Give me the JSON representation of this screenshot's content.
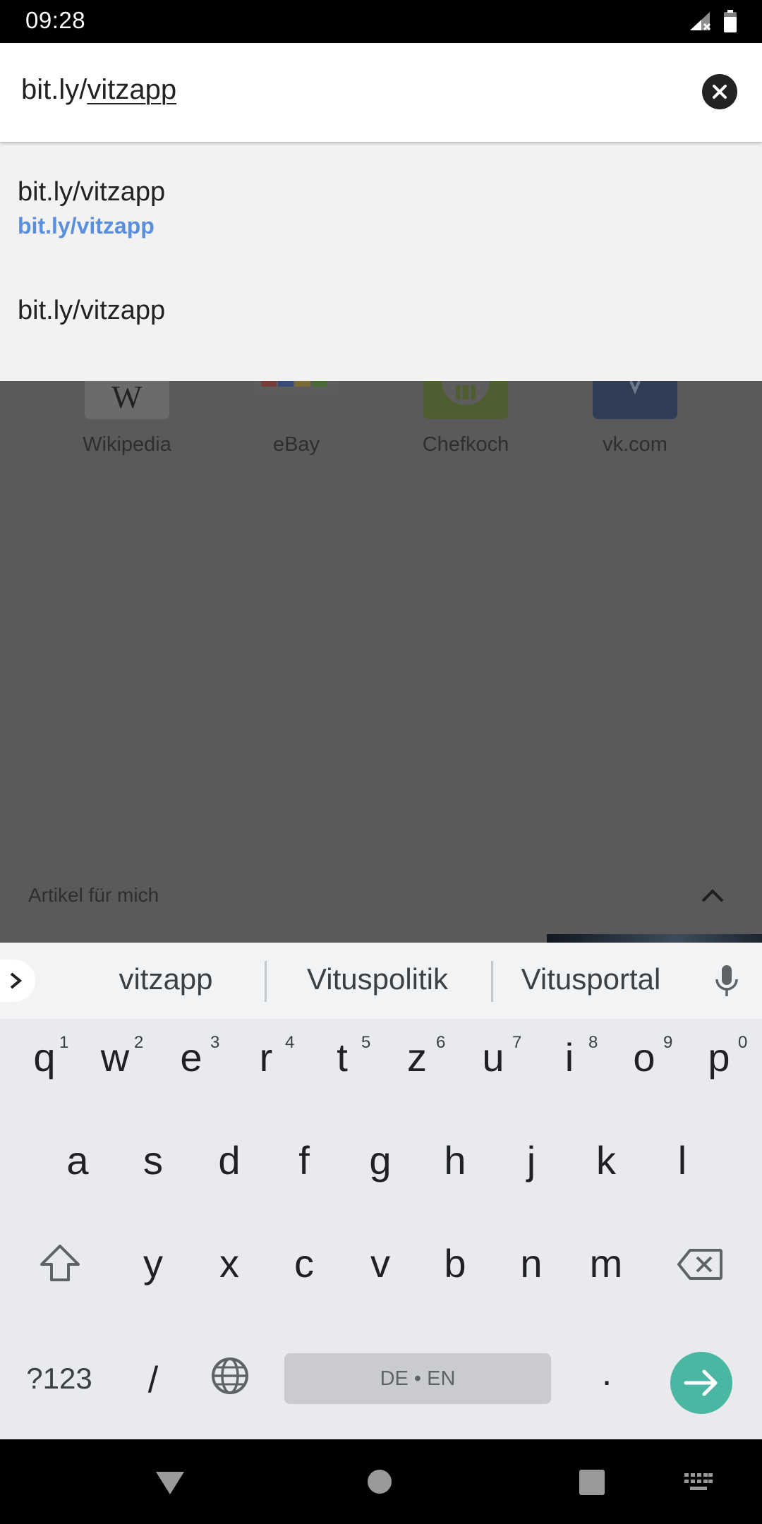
{
  "status_bar": {
    "time": "09:28"
  },
  "url_bar": {
    "prefix": "bit.ly/",
    "typed": "vitzapp"
  },
  "suggestions": [
    {
      "title": "bit.ly/vitzapp",
      "url": "bit.ly/vitzapp"
    },
    {
      "title": "bit.ly/vitzapp"
    }
  ],
  "tiles": [
    {
      "label": "Wikipedia"
    },
    {
      "label": "eBay"
    },
    {
      "label": "Chefkoch"
    },
    {
      "label": "vk.com"
    }
  ],
  "articles": {
    "label": "Artikel für mich"
  },
  "keyboard": {
    "suggestions": [
      "vitzapp",
      "Vituspolitik",
      "Vitusportal"
    ],
    "row1": [
      "q",
      "w",
      "e",
      "r",
      "t",
      "z",
      "u",
      "i",
      "o",
      "p"
    ],
    "row1_hints": [
      "1",
      "2",
      "3",
      "4",
      "5",
      "6",
      "7",
      "8",
      "9",
      "0"
    ],
    "row2": [
      "a",
      "s",
      "d",
      "f",
      "g",
      "h",
      "j",
      "k",
      "l"
    ],
    "row3": [
      "y",
      "x",
      "c",
      "v",
      "b",
      "n",
      "m"
    ],
    "symbols_label": "?123",
    "slash_label": "/",
    "space_label": "DE • EN",
    "period_label": "."
  }
}
